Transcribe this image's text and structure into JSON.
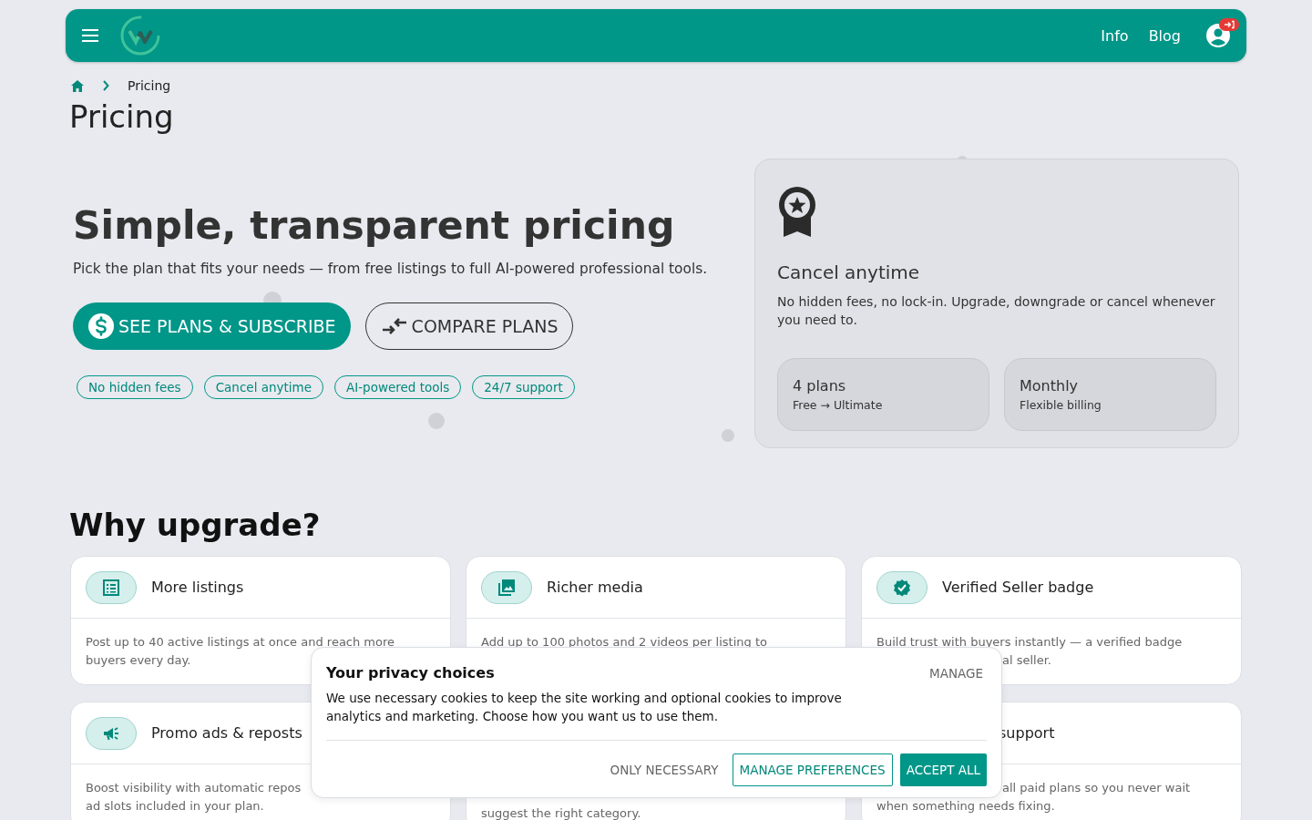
{
  "header": {
    "nav": [
      "Info",
      "Blog"
    ]
  },
  "breadcrumb": {
    "current": "Pricing"
  },
  "page_title": "Pricing",
  "hero": {
    "heading": "Simple, transparent pricing",
    "subheading": "Pick the plan that fits your needs — from free listings to full AI-powered professional tools.",
    "buttons": [
      {
        "label": "SEE PLANS & SUBSCRIBE",
        "kind": "primary"
      },
      {
        "label": "COMPARE PLANS",
        "kind": "outline"
      }
    ],
    "tags": [
      "No hidden fees",
      "Cancel anytime",
      "AI-powered tools",
      "24/7 support"
    ]
  },
  "feature_card": {
    "title": "Cancel anytime",
    "text": "No hidden fees, no lock-in. Upgrade, downgrade or cancel whenever you need to.",
    "stats": [
      {
        "value": "4 plans",
        "caption": "Free → Ultimate"
      },
      {
        "value": "Monthly",
        "caption": "Flexible billing"
      }
    ]
  },
  "why_upgrade": {
    "heading": "Why upgrade?",
    "cards": [
      {
        "title": "More listings",
        "kind": "full",
        "lines": [
          {
            "text": "Post up to 40 active listings at once and reach more",
            "kind": "full"
          },
          {
            "text": "buyers every day.",
            "kind": "full"
          }
        ]
      },
      {
        "title": "Richer media",
        "kind": "full",
        "lines": [
          {
            "text": "Add up to 100 photos and 2 videos per listing to",
            "kind": "full"
          }
        ]
      },
      {
        "title": "Verified Seller badge",
        "kind": "full",
        "lines": [
          {
            "text": "Build trust with buyers instantly — a verified badge",
            "kind": "full"
          },
          {
            "text": "al seller.",
            "kind": "tail"
          }
        ]
      },
      {
        "title": "Promo ads & reposts",
        "kind": "full",
        "lines": [
          {
            "text": "Boost visibility with automatic repos",
            "kind": "full"
          },
          {
            "text": "ad slots included in your plan.",
            "kind": "full"
          }
        ]
      },
      {
        "kind": "covered",
        "lines": [
          {
            "text": "suggest the right category.",
            "kind": "below"
          }
        ]
      },
      {
        "title": "support",
        "kind": "covered-left",
        "lines": [
          {
            "text": "all paid plans so you never wait",
            "kind": "tail"
          },
          {
            "text": "when something needs fixing.",
            "kind": "full"
          }
        ]
      }
    ]
  },
  "cookie_dialog": {
    "title": "Your privacy choices",
    "manage": "MANAGE",
    "text": "We use necessary cookies to keep the site working and optional cookies to improve analytics and marketing. Choose how you want us to use them.",
    "buttons": [
      {
        "label": "ONLY NECESSARY",
        "kind": "text"
      },
      {
        "label": "MANAGE PREFERENCES",
        "kind": "outline"
      },
      {
        "label": "ACCEPT ALL",
        "kind": "primary"
      }
    ]
  }
}
